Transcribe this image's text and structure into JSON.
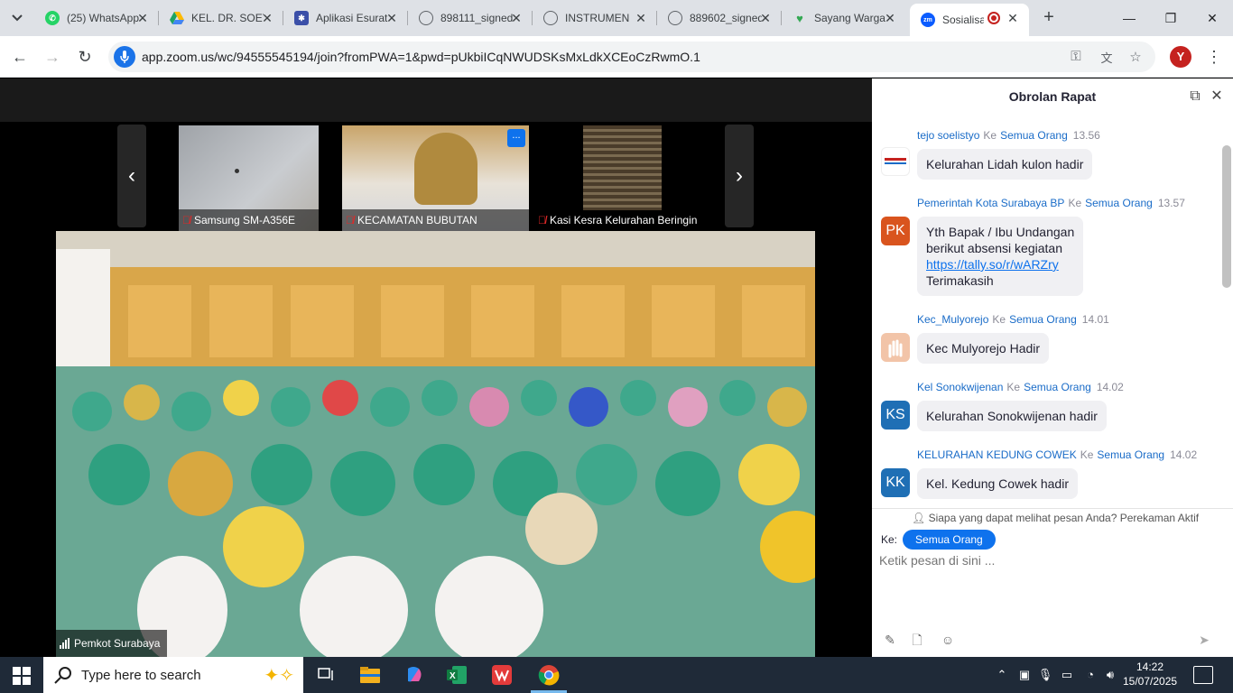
{
  "browser": {
    "tabs": [
      {
        "title": "(25) WhatsApp",
        "icon": "whatsapp-icon",
        "color": "#25d366"
      },
      {
        "title": "KEL. DR. SOETOMO",
        "icon": "google-drive-icon",
        "color": "#1fa463"
      },
      {
        "title": "Aplikasi Esurat",
        "icon": "app-icon",
        "color": "#3b4fa8"
      },
      {
        "title": "898111_signed",
        "icon": "globe-icon",
        "color": "#5f6368"
      },
      {
        "title": "INSTRUMEN",
        "icon": "globe-icon",
        "color": "#5f6368"
      },
      {
        "title": "889602_signed",
        "icon": "globe-icon",
        "color": "#5f6368"
      },
      {
        "title": "Sayang Warga",
        "icon": "sayang-warga-icon",
        "color": "#34a853"
      },
      {
        "title": "Sosialisasi",
        "icon": "zoom-icon",
        "color": "#0b5cff",
        "active": true
      }
    ],
    "url": "app.zoom.us/wc/94555545194/join?fromPWA=1&pwd=pUkbiICqNWUDSKsMxLdkXCEoCzRwmO.1",
    "profile_initial": "Y"
  },
  "meeting": {
    "participants": [
      {
        "name": "Samsung SM-A356E",
        "muted": true
      },
      {
        "name": "KECAMATAN BUBUTAN",
        "muted": true,
        "more": "..."
      },
      {
        "name": "Kasi Kesra Kelurahan Beringin",
        "muted": true
      }
    ],
    "active_speaker": "Pemkot Surabaya"
  },
  "chat": {
    "title": "Obrolan Rapat",
    "to_word": "Ke",
    "messages": [
      {
        "sender": "tejo soelistyo",
        "to": "Semua Orang",
        "time": "13.56",
        "avatar": "logo",
        "avatar_color": "#ffffff",
        "text": "Kelurahan Lidah kulon hadir"
      },
      {
        "sender": "Pemerintah Kota Surabaya BP",
        "to": "Semua Orang",
        "time": "13.57",
        "avatar": "PK",
        "avatar_color": "#d9541e",
        "lines": [
          "Yth Bapak / Ibu Undangan",
          "berikut absensi kegiatan"
        ],
        "link": "https://tally.so/r/wARZry",
        "closing": "Terimakasih"
      },
      {
        "sender": "Kec_Mulyorejo",
        "to": "Semua Orang",
        "time": "14.01",
        "avatar": "photo",
        "avatar_color": "#f2c4a8",
        "text": "Kec Mulyorejo Hadir"
      },
      {
        "sender": "Kel Sonokwijenan",
        "to": "Semua Orang",
        "time": "14.02",
        "avatar": "KS",
        "avatar_color": "#1f6fb5",
        "text": "Kelurahan Sonokwijenan hadir"
      },
      {
        "sender": "KELURAHAN KEDUNG COWEK",
        "to": "Semua Orang",
        "time": "14.02",
        "avatar": "KK",
        "avatar_color": "#1f6fb5",
        "text": "Kel. Kedung Cowek hadir"
      }
    ],
    "privacy_note": "Siapa yang dapat melihat pesan Anda? Perekaman Aktif",
    "to_label": "Ke:",
    "to_value": "Semua Orang",
    "input_placeholder": "Ketik pesan di sini ..."
  },
  "taskbar": {
    "search_placeholder": "Type here to search",
    "time": "14:22",
    "date": "15/07/2025"
  }
}
